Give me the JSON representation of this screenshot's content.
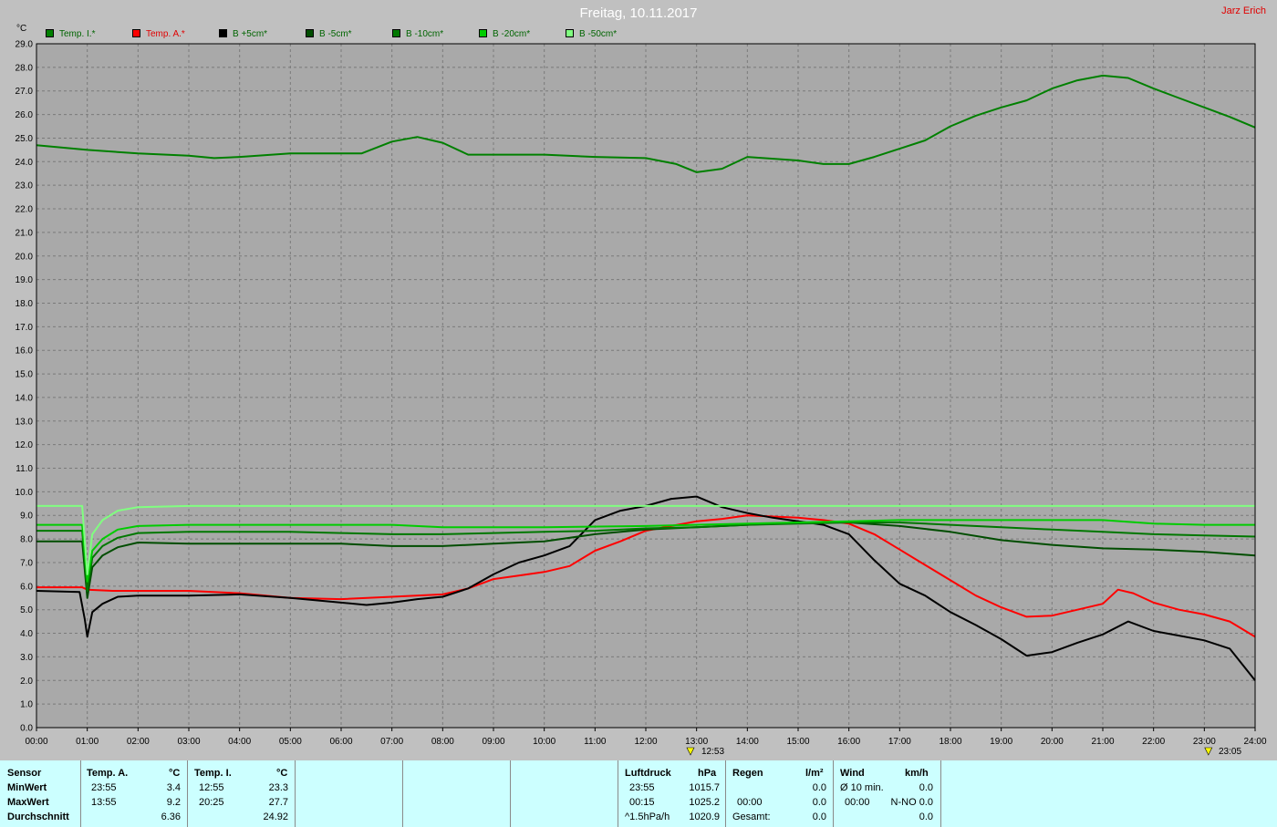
{
  "header": {
    "title": "Freitag, 10.11.2017",
    "author": "Jarz Erich",
    "unit": "°C"
  },
  "legend": [
    {
      "label": "Temp. I.*",
      "color": "#008000"
    },
    {
      "label": "Temp. A.*",
      "color": "#ff0000"
    },
    {
      "label": "B +5cm*",
      "color": "#000000"
    },
    {
      "label": "B -5cm*",
      "color": "#004d00"
    },
    {
      "label": "B -10cm*",
      "color": "#007800"
    },
    {
      "label": "B -20cm*",
      "color": "#00cc00"
    },
    {
      "label": "B -50cm*",
      "color": "#80ff80"
    }
  ],
  "markers": {
    "min_time": "12:53",
    "max_time": "23:05"
  },
  "chart_data": {
    "type": "line",
    "xlabel": "",
    "ylabel": "°C",
    "xlim": [
      0,
      24
    ],
    "ylim": [
      0,
      29
    ],
    "x_ticks": [
      "00:00",
      "01:00",
      "02:00",
      "03:00",
      "04:00",
      "05:00",
      "06:00",
      "07:00",
      "08:00",
      "09:00",
      "10:00",
      "11:00",
      "12:00",
      "13:00",
      "14:00",
      "15:00",
      "16:00",
      "17:00",
      "18:00",
      "19:00",
      "20:00",
      "21:00",
      "22:00",
      "23:00",
      "24:00"
    ],
    "y_ticks": [
      "0.0",
      "1.0",
      "2.0",
      "3.0",
      "4.0",
      "5.0",
      "6.0",
      "7.0",
      "8.0",
      "9.0",
      "10.0",
      "11.0",
      "12.0",
      "13.0",
      "14.0",
      "15.0",
      "16.0",
      "17.0",
      "18.0",
      "19.0",
      "20.0",
      "21.0",
      "22.0",
      "23.0",
      "24.0",
      "25.0",
      "26.0",
      "27.0",
      "28.0",
      "29.0"
    ],
    "grid": true,
    "series": [
      {
        "name": "Temp. I.*",
        "color": "#008000",
        "points": [
          [
            0,
            24.7
          ],
          [
            1,
            24.5
          ],
          [
            2,
            24.35
          ],
          [
            3,
            24.25
          ],
          [
            3.5,
            24.15
          ],
          [
            4,
            24.2
          ],
          [
            5,
            24.35
          ],
          [
            6,
            24.35
          ],
          [
            6.4,
            24.35
          ],
          [
            7,
            24.85
          ],
          [
            7.5,
            25.05
          ],
          [
            8,
            24.8
          ],
          [
            8.5,
            24.3
          ],
          [
            9,
            24.3
          ],
          [
            10,
            24.3
          ],
          [
            11,
            24.2
          ],
          [
            12,
            24.15
          ],
          [
            12.6,
            23.9
          ],
          [
            13,
            23.55
          ],
          [
            13.5,
            23.7
          ],
          [
            14,
            24.2
          ],
          [
            15,
            24.05
          ],
          [
            15.5,
            23.9
          ],
          [
            16,
            23.9
          ],
          [
            16.5,
            24.2
          ],
          [
            17,
            24.55
          ],
          [
            17.5,
            24.9
          ],
          [
            18,
            25.5
          ],
          [
            18.5,
            25.95
          ],
          [
            19,
            26.3
          ],
          [
            19.5,
            26.6
          ],
          [
            20,
            27.1
          ],
          [
            20.5,
            27.45
          ],
          [
            21,
            27.65
          ],
          [
            21.5,
            27.55
          ],
          [
            22,
            27.1
          ],
          [
            22.5,
            26.7
          ],
          [
            23,
            26.3
          ],
          [
            23.5,
            25.9
          ],
          [
            24,
            25.45
          ]
        ]
      },
      {
        "name": "Temp. A.*",
        "color": "#ff0000",
        "points": [
          [
            0,
            5.95
          ],
          [
            0.9,
            5.95
          ],
          [
            1,
            5.85
          ],
          [
            1.5,
            5.8
          ],
          [
            2,
            5.8
          ],
          [
            3,
            5.8
          ],
          [
            4,
            5.7
          ],
          [
            5,
            5.5
          ],
          [
            6,
            5.45
          ],
          [
            7,
            5.55
          ],
          [
            8,
            5.65
          ],
          [
            8.5,
            5.9
          ],
          [
            9,
            6.3
          ],
          [
            9.5,
            6.45
          ],
          [
            10,
            6.6
          ],
          [
            10.5,
            6.85
          ],
          [
            11,
            7.5
          ],
          [
            11.5,
            7.9
          ],
          [
            12,
            8.35
          ],
          [
            12.5,
            8.55
          ],
          [
            13,
            8.75
          ],
          [
            13.5,
            8.85
          ],
          [
            14,
            9.0
          ],
          [
            15,
            8.9
          ],
          [
            15.5,
            8.8
          ],
          [
            16,
            8.65
          ],
          [
            16.5,
            8.2
          ],
          [
            17,
            7.55
          ],
          [
            17.5,
            6.9
          ],
          [
            18,
            6.25
          ],
          [
            18.5,
            5.6
          ],
          [
            19,
            5.1
          ],
          [
            19.5,
            4.7
          ],
          [
            20,
            4.75
          ],
          [
            20.5,
            5.0
          ],
          [
            21,
            5.25
          ],
          [
            21.3,
            5.85
          ],
          [
            21.6,
            5.7
          ],
          [
            22,
            5.3
          ],
          [
            22.5,
            5.0
          ],
          [
            23,
            4.8
          ],
          [
            23.5,
            4.5
          ],
          [
            24,
            3.85
          ]
        ]
      },
      {
        "name": "B +5cm*",
        "color": "#000000",
        "points": [
          [
            0,
            5.8
          ],
          [
            0.85,
            5.75
          ],
          [
            0.95,
            4.6
          ],
          [
            1.0,
            3.85
          ],
          [
            1.1,
            4.9
          ],
          [
            1.3,
            5.25
          ],
          [
            1.6,
            5.55
          ],
          [
            2,
            5.6
          ],
          [
            3,
            5.6
          ],
          [
            4,
            5.65
          ],
          [
            5,
            5.5
          ],
          [
            6,
            5.3
          ],
          [
            6.5,
            5.2
          ],
          [
            7,
            5.3
          ],
          [
            7.5,
            5.45
          ],
          [
            8,
            5.55
          ],
          [
            8.5,
            5.9
          ],
          [
            9,
            6.5
          ],
          [
            9.5,
            7.0
          ],
          [
            10,
            7.3
          ],
          [
            10.5,
            7.7
          ],
          [
            11,
            8.8
          ],
          [
            11.5,
            9.2
          ],
          [
            12,
            9.4
          ],
          [
            12.5,
            9.7
          ],
          [
            13,
            9.8
          ],
          [
            13.5,
            9.35
          ],
          [
            14,
            9.1
          ],
          [
            14.5,
            8.9
          ],
          [
            15,
            8.75
          ],
          [
            15.5,
            8.6
          ],
          [
            16,
            8.2
          ],
          [
            16.5,
            7.1
          ],
          [
            17,
            6.1
          ],
          [
            17.5,
            5.6
          ],
          [
            18,
            4.9
          ],
          [
            18.5,
            4.35
          ],
          [
            19,
            3.75
          ],
          [
            19.5,
            3.05
          ],
          [
            20,
            3.2
          ],
          [
            20.5,
            3.6
          ],
          [
            21,
            3.95
          ],
          [
            21.5,
            4.5
          ],
          [
            22,
            4.1
          ],
          [
            22.5,
            3.9
          ],
          [
            23,
            3.7
          ],
          [
            23.5,
            3.35
          ],
          [
            24,
            2.0
          ]
        ]
      },
      {
        "name": "B -5cm*",
        "color": "#004d00",
        "points": [
          [
            0,
            7.9
          ],
          [
            0.9,
            7.9
          ],
          [
            1.0,
            5.5
          ],
          [
            1.1,
            6.8
          ],
          [
            1.3,
            7.3
          ],
          [
            1.6,
            7.65
          ],
          [
            2,
            7.85
          ],
          [
            3,
            7.8
          ],
          [
            5,
            7.8
          ],
          [
            6,
            7.8
          ],
          [
            7,
            7.7
          ],
          [
            8,
            7.7
          ],
          [
            9,
            7.8
          ],
          [
            10,
            7.9
          ],
          [
            11,
            8.2
          ],
          [
            12,
            8.4
          ],
          [
            13,
            8.5
          ],
          [
            14,
            8.6
          ],
          [
            15,
            8.7
          ],
          [
            16,
            8.7
          ],
          [
            17,
            8.55
          ],
          [
            18,
            8.3
          ],
          [
            19,
            7.95
          ],
          [
            20,
            7.75
          ],
          [
            21,
            7.6
          ],
          [
            22,
            7.55
          ],
          [
            23,
            7.45
          ],
          [
            24,
            7.3
          ]
        ]
      },
      {
        "name": "B -10cm*",
        "color": "#007800",
        "points": [
          [
            0,
            8.35
          ],
          [
            0.9,
            8.35
          ],
          [
            1.0,
            5.8
          ],
          [
            1.1,
            7.2
          ],
          [
            1.3,
            7.7
          ],
          [
            1.6,
            8.05
          ],
          [
            2,
            8.25
          ],
          [
            3,
            8.3
          ],
          [
            5,
            8.3
          ],
          [
            6,
            8.25
          ],
          [
            7,
            8.2
          ],
          [
            8,
            8.2
          ],
          [
            9,
            8.25
          ],
          [
            10,
            8.3
          ],
          [
            11,
            8.35
          ],
          [
            12,
            8.45
          ],
          [
            13,
            8.5
          ],
          [
            14,
            8.6
          ],
          [
            15,
            8.65
          ],
          [
            16,
            8.7
          ],
          [
            17,
            8.7
          ],
          [
            18,
            8.6
          ],
          [
            19,
            8.5
          ],
          [
            20,
            8.4
          ],
          [
            21,
            8.3
          ],
          [
            22,
            8.2
          ],
          [
            23,
            8.15
          ],
          [
            24,
            8.1
          ]
        ]
      },
      {
        "name": "B -20cm*",
        "color": "#00cc00",
        "points": [
          [
            0,
            8.6
          ],
          [
            0.9,
            8.6
          ],
          [
            1.0,
            6.2
          ],
          [
            1.1,
            7.5
          ],
          [
            1.3,
            8.0
          ],
          [
            1.6,
            8.4
          ],
          [
            2,
            8.55
          ],
          [
            3,
            8.6
          ],
          [
            5,
            8.6
          ],
          [
            7,
            8.6
          ],
          [
            8,
            8.5
          ],
          [
            10,
            8.5
          ],
          [
            12,
            8.55
          ],
          [
            14,
            8.65
          ],
          [
            16,
            8.75
          ],
          [
            17,
            8.8
          ],
          [
            18,
            8.8
          ],
          [
            20,
            8.8
          ],
          [
            21,
            8.8
          ],
          [
            22,
            8.65
          ],
          [
            23,
            8.6
          ],
          [
            24,
            8.6
          ]
        ]
      },
      {
        "name": "B -50cm*",
        "color": "#80ff80",
        "points": [
          [
            0,
            9.4
          ],
          [
            0.9,
            9.4
          ],
          [
            1.0,
            6.5
          ],
          [
            1.1,
            8.2
          ],
          [
            1.3,
            8.8
          ],
          [
            1.6,
            9.2
          ],
          [
            2,
            9.35
          ],
          [
            3,
            9.4
          ],
          [
            24,
            9.4
          ]
        ]
      }
    ]
  },
  "panel": {
    "sensor": {
      "label": "Sensor",
      "min": "MinWert",
      "max": "MaxWert",
      "avg": "Durchschnitt"
    },
    "temp_a": {
      "label": "Temp. A.",
      "unit": "°C",
      "min_time": "23:55",
      "min_val": "3.4",
      "max_time": "13:55",
      "max_val": "9.2",
      "avg": "6.36"
    },
    "temp_i": {
      "label": "Temp. I.",
      "unit": "°C",
      "min_time": "12:55",
      "min_val": "23.3",
      "max_time": "20:25",
      "max_val": "27.7",
      "avg": "24.92"
    },
    "pressure": {
      "label": "Luftdruck",
      "unit": "hPa",
      "min_time": "23:55",
      "min_val": "1015.7",
      "max_time": "00:15",
      "max_val": "1025.2",
      "trend": "^1.5hPa/h",
      "trend_val": "1020.9"
    },
    "rain": {
      "label": "Regen",
      "unit": "l/m²",
      "row1": "0.0",
      "max_time": "00:00",
      "row2": "0.0",
      "total_label": "Gesamt:",
      "total": "0.0"
    },
    "wind": {
      "label": "Wind",
      "unit": "km/h",
      "avg_label": "Ø 10 min.",
      "avg_val": "0.0",
      "max_time": "00:00",
      "max_val": "N-NO 0.0",
      "row3": "0.0"
    }
  }
}
